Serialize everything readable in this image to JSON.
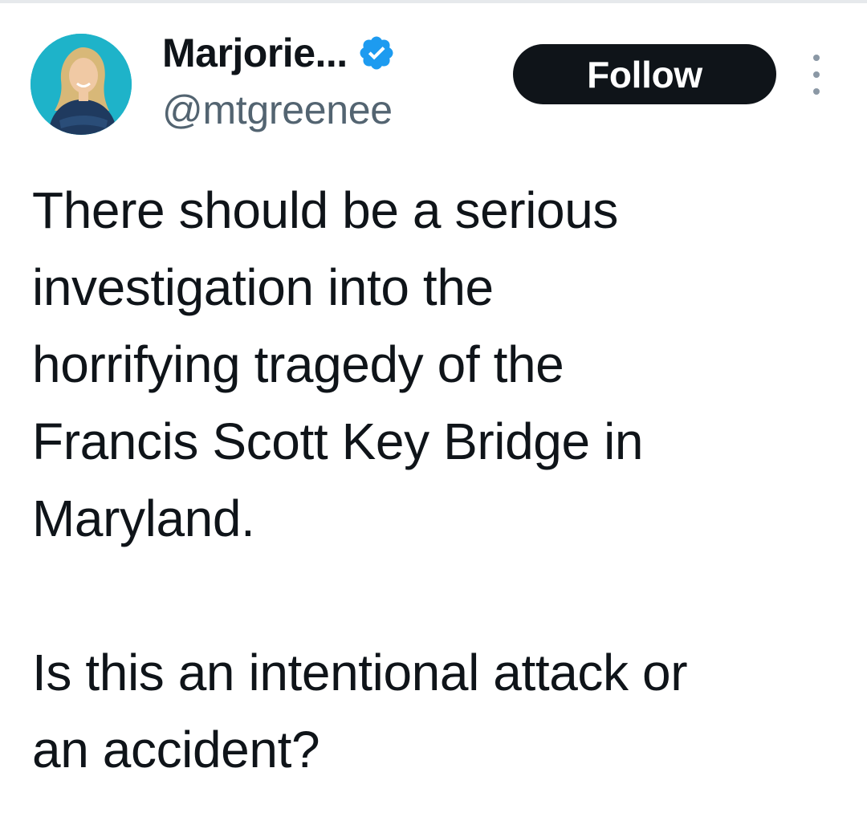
{
  "author": {
    "display_name": "Marjorie...",
    "handle": "@mtgreenee",
    "verified": true,
    "avatar_icon": "profile-photo"
  },
  "actions": {
    "follow_label": "Follow",
    "more_icon": "more-vertical-icon"
  },
  "tweet": {
    "paragraph_1": "There should be a serious\ninvestigation into the\nhorrifying tragedy of the\nFrancis Scott Key Bridge in\nMaryland.",
    "paragraph_2": "Is this an intentional attack or\nan accident?"
  },
  "colors": {
    "text_primary": "#0f1419",
    "text_secondary": "#536471",
    "verified_blue": "#1d9bf0",
    "button_bg": "#0f1419",
    "avatar_bg": "#1eb3c9"
  }
}
